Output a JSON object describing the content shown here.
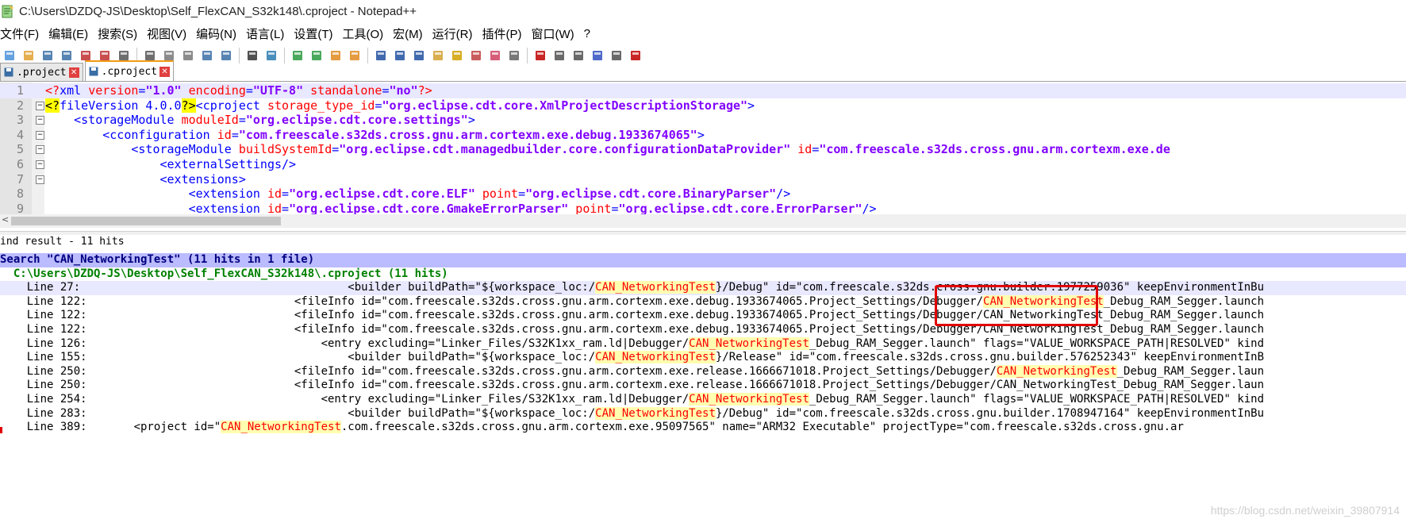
{
  "window": {
    "title": "C:\\Users\\DZDQ-JS\\Desktop\\Self_FlexCAN_S32k148\\.cproject - Notepad++"
  },
  "menu": [
    "文件(F)",
    "编辑(E)",
    "搜索(S)",
    "视图(V)",
    "编码(N)",
    "语言(L)",
    "设置(T)",
    "工具(O)",
    "宏(M)",
    "运行(R)",
    "插件(P)",
    "窗口(W)",
    "?"
  ],
  "toolbar_icons": [
    "new-file-icon",
    "open-file-icon",
    "save-icon",
    "save-all-icon",
    "close-icon",
    "close-all-icon",
    "print-icon",
    "cut-icon",
    "copy-icon",
    "paste-icon",
    "undo-icon",
    "redo-icon",
    "find-icon",
    "replace-icon",
    "zoom-in-icon",
    "zoom-out-icon",
    "sync-v-icon",
    "sync-h-icon",
    "word-wrap-icon",
    "show-all-chars-icon",
    "indent-guide-icon",
    "folder-as-workspace-icon",
    "doc-map-icon",
    "function-list-icon",
    "doc-list-icon",
    "monitor-icon",
    "record-macro-icon",
    "stop-macro-icon",
    "play-macro-icon",
    "run-macro-multiple-icon",
    "save-macro-icon",
    "spell-check-icon"
  ],
  "tabs": [
    {
      "label": ".project",
      "active": false
    },
    {
      "label": ".cproject",
      "active": true
    }
  ],
  "editor": {
    "lines": [
      {
        "n": "1",
        "parts": [
          [
            "pi",
            "<?"
          ],
          [
            "tag",
            "xml "
          ],
          [
            "attr",
            "version"
          ],
          [
            "tag",
            "="
          ],
          [
            "val",
            "\"1.0\""
          ],
          [
            "tag",
            " "
          ],
          [
            "attr",
            "encoding"
          ],
          [
            "tag",
            "="
          ],
          [
            "val",
            "\"UTF-8\""
          ],
          [
            "tag",
            " "
          ],
          [
            "attr",
            "standalone"
          ],
          [
            "tag",
            "="
          ],
          [
            "val",
            "\"no\""
          ],
          [
            "pi",
            "?>"
          ]
        ]
      },
      {
        "n": "2",
        "parts": [
          [
            "hl",
            "<?"
          ],
          [
            "tag",
            "fileVersion 4.0.0"
          ],
          [
            "hl",
            "?>"
          ],
          [
            "tag",
            "<cproject "
          ],
          [
            "attr",
            "storage_type_id"
          ],
          [
            "tag",
            "="
          ],
          [
            "val",
            "\"org.eclipse.cdt.core.XmlProjectDescriptionStorage\""
          ],
          [
            "tag",
            ">"
          ]
        ]
      },
      {
        "n": "3",
        "parts": [
          [
            "tag",
            "    <storageModule "
          ],
          [
            "attr",
            "moduleId"
          ],
          [
            "tag",
            "="
          ],
          [
            "val",
            "\"org.eclipse.cdt.core.settings\""
          ],
          [
            "tag",
            ">"
          ]
        ]
      },
      {
        "n": "4",
        "parts": [
          [
            "tag",
            "        <cconfiguration "
          ],
          [
            "attr",
            "id"
          ],
          [
            "tag",
            "="
          ],
          [
            "val",
            "\"com.freescale.s32ds.cross.gnu.arm.cortexm.exe.debug.1933674065\""
          ],
          [
            "tag",
            ">"
          ]
        ]
      },
      {
        "n": "5",
        "parts": [
          [
            "tag",
            "            <storageModule "
          ],
          [
            "attr",
            "buildSystemId"
          ],
          [
            "tag",
            "="
          ],
          [
            "val",
            "\"org.eclipse.cdt.managedbuilder.core.configurationDataProvider\""
          ],
          [
            "tag",
            " "
          ],
          [
            "attr",
            "id"
          ],
          [
            "tag",
            "="
          ],
          [
            "val",
            "\"com.freescale.s32ds.cross.gnu.arm.cortexm.exe.de"
          ]
        ]
      },
      {
        "n": "6",
        "parts": [
          [
            "tag",
            "                <externalSettings/>"
          ]
        ]
      },
      {
        "n": "7",
        "parts": [
          [
            "tag",
            "                <extensions>"
          ]
        ]
      },
      {
        "n": "8",
        "parts": [
          [
            "tag",
            "                    <extension "
          ],
          [
            "attr",
            "id"
          ],
          [
            "tag",
            "="
          ],
          [
            "val",
            "\"org.eclipse.cdt.core.ELF\""
          ],
          [
            "tag",
            " "
          ],
          [
            "attr",
            "point"
          ],
          [
            "tag",
            "="
          ],
          [
            "val",
            "\"org.eclipse.cdt.core.BinaryParser\""
          ],
          [
            "tag",
            "/>"
          ]
        ]
      },
      {
        "n": "9",
        "parts": [
          [
            "tag",
            "                    <extension "
          ],
          [
            "attr",
            "id"
          ],
          [
            "tag",
            "="
          ],
          [
            "val",
            "\"org.eclipse.cdt.core.GmakeErrorParser\""
          ],
          [
            "tag",
            " "
          ],
          [
            "attr",
            "point"
          ],
          [
            "tag",
            "="
          ],
          [
            "val",
            "\"org.eclipse.cdt.core.ErrorParser\""
          ],
          [
            "tag",
            "/>"
          ]
        ]
      }
    ]
  },
  "find": {
    "title": "ind result - 11 hits",
    "search_line": "Search \"CAN_NetworkingTest\" (11 hits in 1 file)",
    "file_line": "  C:\\Users\\DZDQ-JS\\Desktop\\Self_FlexCAN_S32k148\\.cproject (11 hits)",
    "keyword": "CAN_NetworkingTest",
    "hits": [
      {
        "pre": "    Line 27:                                        <builder buildPath=\"${workspace_loc:/",
        "post": "}/Debug\" id=\"com.freescale.s32ds.cross.gnu.builder.1977259036\" keepEnvironmentInBu"
      },
      {
        "pre": "    Line 122:                               <fileInfo id=\"com.freescale.s32ds.cross.gnu.arm.cortexm.exe.debug.1933674065.Project_Settings/Debugger/",
        "post": "_Debug_RAM_Segger.launch"
      },
      {
        "pre": "    Line 122:                               <fileInfo id=\"com.freescale.s32ds.cross.gnu.arm.cortexm.exe.debug.1933674065.Project_Settings/Debugger/CAN_NetworkingTest_Debug_RAM_Segger.launch",
        "post": "",
        "plain": true
      },
      {
        "pre": "    Line 122:                               <fileInfo id=\"com.freescale.s32ds.cross.gnu.arm.cortexm.exe.debug.1933674065.Project_Settings/Debugger/CAN_NetworkingTest_Debug_RAM_Segger.launch",
        "post": "",
        "plain": true
      },
      {
        "pre": "    Line 126:                                   <entry excluding=\"Linker_Files/S32K1xx_ram.ld|Debugger/",
        "post": "_Debug_RAM_Segger.launch\" flags=\"VALUE_WORKSPACE_PATH|RESOLVED\" kind"
      },
      {
        "pre": "    Line 155:                                       <builder buildPath=\"${workspace_loc:/",
        "post": "}/Release\" id=\"com.freescale.s32ds.cross.gnu.builder.576252343\" keepEnvironmentInB"
      },
      {
        "pre": "    Line 250:                               <fileInfo id=\"com.freescale.s32ds.cross.gnu.arm.cortexm.exe.release.1666671018.Project_Settings/Debugger/",
        "post": "_Debug_RAM_Segger.laun"
      },
      {
        "pre": "    Line 250:                               <fileInfo id=\"com.freescale.s32ds.cross.gnu.arm.cortexm.exe.release.1666671018.Project_Settings/Debugger/CAN_NetworkingTest_Debug_RAM_Segger.laun",
        "post": "",
        "plain": true
      },
      {
        "pre": "    Line 254:                                   <entry excluding=\"Linker_Files/S32K1xx_ram.ld|Debugger/",
        "post": "_Debug_RAM_Segger.launch\" flags=\"VALUE_WORKSPACE_PATH|RESOLVED\" kind"
      },
      {
        "pre": "    Line 283:                                       <builder buildPath=\"${workspace_loc:/",
        "post": "}/Debug\" id=\"com.freescale.s32ds.cross.gnu.builder.1708947164\" keepEnvironmentInBu"
      },
      {
        "pre": "    Line 389:       <project id=\"",
        "post": ".com.freescale.s32ds.cross.gnu.arm.cortexm.exe.95097565\" name=\"ARM32 Executable\" projectType=\"com.freescale.s32ds.cross.gnu.ar"
      }
    ]
  },
  "watermark": "https://blog.csdn.net/weixin_39807914",
  "colors": {
    "search_bg": "#bbbbff",
    "file_green": "#008000",
    "hit_red": "#ff0000",
    "annotation_box": "#e00000"
  }
}
